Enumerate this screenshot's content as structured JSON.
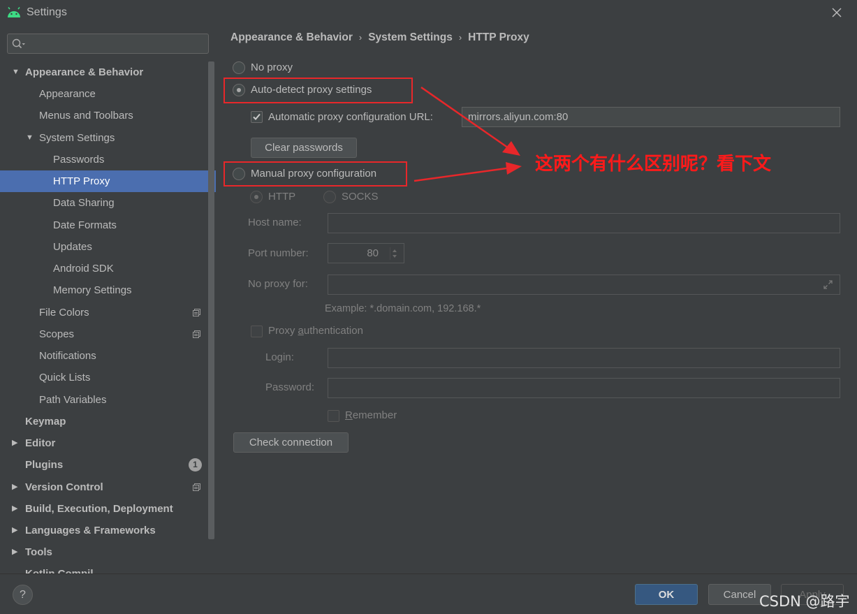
{
  "window": {
    "title": "Settings"
  },
  "sidebar": {
    "search_placeholder": "",
    "items": [
      {
        "label": "Appearance & Behavior",
        "arrow": "▼"
      },
      {
        "label": "Appearance"
      },
      {
        "label": "Menus and Toolbars"
      },
      {
        "label": "System Settings",
        "arrow": "▼"
      },
      {
        "label": "Passwords"
      },
      {
        "label": "HTTP Proxy"
      },
      {
        "label": "Data Sharing"
      },
      {
        "label": "Date Formats"
      },
      {
        "label": "Updates"
      },
      {
        "label": "Android SDK"
      },
      {
        "label": "Memory Settings"
      },
      {
        "label": "File Colors"
      },
      {
        "label": "Scopes"
      },
      {
        "label": "Notifications"
      },
      {
        "label": "Quick Lists"
      },
      {
        "label": "Path Variables"
      },
      {
        "label": "Keymap"
      },
      {
        "label": "Editor",
        "arrow": "▶"
      },
      {
        "label": "Plugins",
        "badge": "1"
      },
      {
        "label": "Version Control",
        "arrow": "▶"
      },
      {
        "label": "Build, Execution, Deployment",
        "arrow": "▶"
      },
      {
        "label": "Languages & Frameworks",
        "arrow": "▶"
      },
      {
        "label": "Tools",
        "arrow": "▶"
      },
      {
        "label": "Kotlin Compil..."
      }
    ]
  },
  "breadcrumb": {
    "part1": "Appearance & Behavior",
    "part2": "System Settings",
    "part3": "HTTP Proxy",
    "sep": "›"
  },
  "proxy": {
    "no_proxy": "No proxy",
    "auto_detect": "Auto-detect proxy settings",
    "auto_config_url_label": "Automatic proxy configuration URL:",
    "auto_config_url_value": "mirrors.aliyun.com:80",
    "clear_passwords": "Clear passwords",
    "manual": "Manual proxy configuration",
    "http": "HTTP",
    "socks": "SOCKS",
    "host_label": "Host name:",
    "host_value": "",
    "port_label": "Port number:",
    "port_value": "80",
    "no_proxy_for_label": "No proxy for:",
    "no_proxy_for_value": "",
    "example": "Example: *.domain.com, 192.168.*",
    "auth_label_pre": "Proxy ",
    "auth_label_u": "a",
    "auth_label_post": "uthentication",
    "login_label": "Login:",
    "login_value": "",
    "password_label": "Password:",
    "password_value": "",
    "remember_u": "R",
    "remember_post": "emember",
    "check_connection": "Check connection"
  },
  "annotation": "这两个有什么区别呢？看下文",
  "footer": {
    "help": "?",
    "ok": "OK",
    "cancel": "Cancel",
    "apply": "Apply",
    "watermark": "CSDN @路宇"
  },
  "colors": {
    "selection": "#4b6eaf",
    "annotation_red": "#e8272a",
    "background": "#3c3f41"
  }
}
